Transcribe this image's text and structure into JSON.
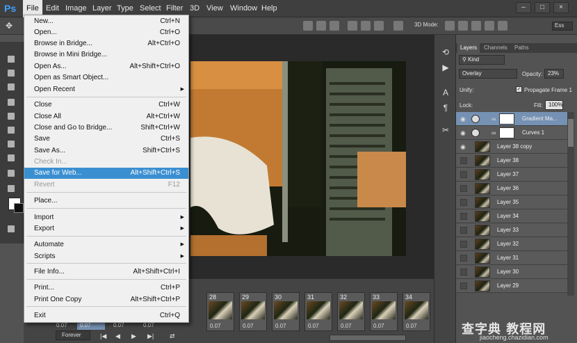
{
  "menubar": {
    "logo": "Ps",
    "items": [
      "File",
      "Edit",
      "Image",
      "Layer",
      "Type",
      "Select",
      "Filter",
      "3D",
      "View",
      "Window",
      "Help"
    ],
    "active": "File"
  },
  "options": {
    "mode_label": "3D Mode:",
    "ess_label": "Ess"
  },
  "file_menu": {
    "items": [
      {
        "label": "New...",
        "shortcut": "Ctrl+N"
      },
      {
        "label": "Open...",
        "shortcut": "Ctrl+O"
      },
      {
        "label": "Browse in Bridge...",
        "shortcut": "Alt+Ctrl+O"
      },
      {
        "label": "Browse in Mini Bridge...",
        "shortcut": ""
      },
      {
        "label": "Open As...",
        "shortcut": "Alt+Shift+Ctrl+O"
      },
      {
        "label": "Open as Smart Object...",
        "shortcut": ""
      },
      {
        "label": "Open Recent",
        "shortcut": "",
        "submenu": true
      },
      {
        "label": "Close",
        "shortcut": "Ctrl+W"
      },
      {
        "label": "Close All",
        "shortcut": "Alt+Ctrl+W"
      },
      {
        "label": "Close and Go to Bridge...",
        "shortcut": "Shift+Ctrl+W"
      },
      {
        "label": "Save",
        "shortcut": "Ctrl+S"
      },
      {
        "label": "Save As...",
        "shortcut": "Shift+Ctrl+S"
      },
      {
        "label": "Check In...",
        "shortcut": "",
        "disabled": true
      },
      {
        "label": "Save for Web...",
        "shortcut": "Alt+Shift+Ctrl+S",
        "highlighted": true
      },
      {
        "label": "Revert",
        "shortcut": "F12",
        "disabled": true
      },
      {
        "label": "Place...",
        "shortcut": ""
      },
      {
        "label": "Import",
        "shortcut": "",
        "submenu": true
      },
      {
        "label": "Export",
        "shortcut": "",
        "submenu": true
      },
      {
        "label": "Automate",
        "shortcut": "",
        "submenu": true
      },
      {
        "label": "Scripts",
        "shortcut": "",
        "submenu": true
      },
      {
        "label": "File Info...",
        "shortcut": "Alt+Shift+Ctrl+I"
      },
      {
        "label": "Print...",
        "shortcut": "Ctrl+P"
      },
      {
        "label": "Print One Copy",
        "shortcut": "Alt+Shift+Ctrl+P"
      },
      {
        "label": "Exit",
        "shortcut": "Ctrl+Q"
      }
    ]
  },
  "panel": {
    "tabs": [
      "Layers",
      "Channels",
      "Paths"
    ],
    "active_tab": "Layers",
    "filter_kind": "Kind",
    "blend_mode": "Overlay",
    "opacity_label": "Opacity:",
    "opacity_value": "23%",
    "unify_label": "Unify:",
    "propagate_label": "Propagate Frame 1",
    "lock_label": "Lock:",
    "fill_label": "Fill:",
    "fill_value": "100%"
  },
  "layers": [
    {
      "name": "Gradient Ma...",
      "type": "adjustment",
      "visible": true,
      "selected": true
    },
    {
      "name": "Curves 1",
      "type": "adjustment",
      "visible": true
    },
    {
      "name": "Layer 38 copy",
      "visible": true
    },
    {
      "name": "Layer 38",
      "visible": false
    },
    {
      "name": "Layer 37",
      "visible": false
    },
    {
      "name": "Layer 36",
      "visible": false
    },
    {
      "name": "Layer 35",
      "visible": false
    },
    {
      "name": "Layer 34",
      "visible": false
    },
    {
      "name": "Layer 33",
      "visible": false
    },
    {
      "name": "Layer 32",
      "visible": false
    },
    {
      "name": "Layer 31",
      "visible": false
    },
    {
      "name": "Layer 30",
      "visible": false
    },
    {
      "name": "Layer 29",
      "visible": false
    }
  ],
  "timeline": {
    "frames": [
      {
        "num": "28",
        "delay": "0.07"
      },
      {
        "num": "29",
        "delay": "0.07"
      },
      {
        "num": "30",
        "delay": "0.07"
      },
      {
        "num": "31",
        "delay": "0.07"
      },
      {
        "num": "32",
        "delay": "0.07"
      },
      {
        "num": "33",
        "delay": "0.07"
      },
      {
        "num": "34",
        "delay": "0.07"
      }
    ],
    "left_delays": [
      "0.07",
      "0.07",
      "0.07",
      "0.07"
    ],
    "loop": "Forever"
  },
  "watermark": {
    "line1": "查字典 教程网",
    "line2": "jiaocheng.chazidian.com"
  }
}
